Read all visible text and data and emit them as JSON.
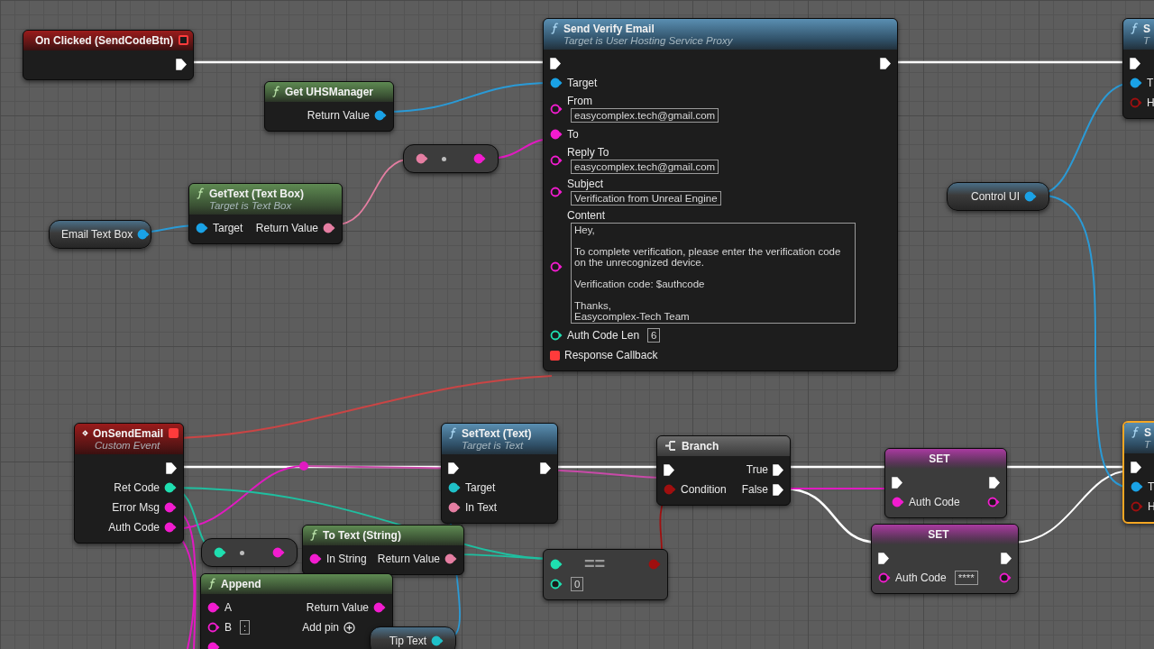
{
  "nodes": [
    {
      "kind": "event",
      "title": "On Clicked (SendCodeBtn)",
      "selected": false,
      "header_pin": {
        "kind": "delegate",
        "color": "#ff3b3b",
        "connected": false
      },
      "rows": [
        {
          "out": {
            "kind": "exec",
            "connected": true
          }
        }
      ]
    },
    {
      "kind": "pure",
      "title": "Get UHSManager",
      "selected": false,
      "rows": [
        {
          "out": {
            "kind": "data",
            "label": "Return Value",
            "color": "#1aa2e6",
            "connected": true
          }
        }
      ]
    },
    {
      "kind": "convert",
      "selected": false,
      "rows": [
        {
          "in": {
            "kind": "data",
            "color": "#e57ea2",
            "connected": true
          },
          "out": {
            "kind": "data",
            "color": "#f21ccf",
            "connected": true
          }
        }
      ]
    },
    {
      "kind": "pure",
      "title": "GetText (Text Box)",
      "subtitle": "Target is Text Box",
      "selected": false,
      "rows": [
        {
          "in": {
            "kind": "data",
            "label": "Target",
            "color": "#1aa2e6",
            "connected": true
          },
          "out": {
            "kind": "data",
            "label": "Return Value",
            "color": "#e57ea2",
            "connected": true
          }
        }
      ]
    },
    {
      "kind": "variable",
      "selected": false,
      "rows": [
        {
          "out": {
            "kind": "data",
            "label": "Email Text Box",
            "color": "#1aa2e6",
            "connected": true
          }
        }
      ]
    },
    {
      "kind": "call",
      "title": "Send Verify Email",
      "subtitle": "Target is User Hosting Service Proxy",
      "selected": false,
      "rows": [
        {
          "in": {
            "kind": "exec",
            "connected": true
          },
          "out": {
            "kind": "exec",
            "connected": true
          }
        },
        {
          "in": {
            "kind": "data",
            "label": "Target",
            "color": "#1aa2e6",
            "connected": true
          }
        },
        {
          "in": {
            "kind": "field",
            "label": "From",
            "color": "#f21ccf",
            "connected": false,
            "value": "easycomplex.tech@gmail.com"
          }
        },
        {
          "in": {
            "kind": "data",
            "label": "To",
            "color": "#f21ccf",
            "connected": true
          }
        },
        {
          "in": {
            "kind": "field",
            "label": "Reply To",
            "color": "#f21ccf",
            "connected": false,
            "value": "easycomplex.tech@gmail.com"
          }
        },
        {
          "in": {
            "kind": "field",
            "label": "Subject",
            "color": "#f21ccf",
            "connected": false,
            "value": "Verification from Unreal Engine"
          }
        },
        {
          "in": {
            "kind": "multiline",
            "label": "Content",
            "color": "#f21ccf",
            "connected": false,
            "value": "Hey,\n\nTo complete verification, please enter the verification code on the unrecognized device.\n\nVerification code: $authcode\n\nThanks,\nEasycomplex-Tech Team"
          }
        },
        {
          "in": {
            "kind": "data",
            "label": "Auth Code Len",
            "color": "#1fdfb0",
            "connected": false,
            "value": "6"
          }
        },
        {
          "in": {
            "kind": "delegate",
            "label": "Response Callback",
            "color": "#ff3b3b",
            "connected": true
          }
        }
      ]
    },
    {
      "kind": "call",
      "title": "S",
      "subtitle": "T",
      "selected": false,
      "rows": [
        {
          "in": {
            "kind": "exec",
            "connected": true
          }
        },
        {
          "in": {
            "kind": "data",
            "label": "T",
            "color": "#1aa2e6",
            "connected": true
          }
        },
        {
          "in": {
            "kind": "data",
            "label": "H",
            "color": "#a00f0f",
            "connected": false
          }
        }
      ]
    },
    {
      "kind": "variable",
      "selected": false,
      "rows": [
        {
          "out": {
            "kind": "data",
            "label": "Control UI",
            "color": "#1aa2e6",
            "connected": true
          }
        }
      ]
    },
    {
      "kind": "event",
      "title": "OnSendEmail",
      "subtitle": "Custom Event",
      "selected": false,
      "header_pin": {
        "kind": "delegate",
        "color": "#ff3b3b",
        "connected": true
      },
      "rows": [
        {
          "out": {
            "kind": "exec",
            "connected": true
          }
        },
        {
          "out": {
            "kind": "data",
            "label": "Ret Code",
            "color": "#1fdfb0",
            "connected": true
          }
        },
        {
          "out": {
            "kind": "data",
            "label": "Error Msg",
            "color": "#f21ccf",
            "connected": true
          }
        },
        {
          "out": {
            "kind": "data",
            "label": "Auth Code",
            "color": "#f21ccf",
            "connected": true
          }
        }
      ]
    },
    {
      "kind": "call",
      "title": "SetText (Text)",
      "subtitle": "Target is Text",
      "selected": false,
      "rows": [
        {
          "in": {
            "kind": "exec",
            "connected": true
          },
          "out": {
            "kind": "exec",
            "connected": true
          }
        },
        {
          "in": {
            "kind": "data",
            "label": "Target",
            "color": "#1fc0c8",
            "connected": true
          }
        },
        {
          "in": {
            "kind": "data",
            "label": "In Text",
            "color": "#e57ea2",
            "connected": true
          }
        }
      ]
    },
    {
      "kind": "branch",
      "title": "Branch",
      "selected": false,
      "rows": [
        {
          "in": {
            "kind": "exec",
            "connected": true
          },
          "out": {
            "kind": "exec",
            "label": "True",
            "connected": true
          }
        },
        {
          "in": {
            "kind": "data",
            "label": "Condition",
            "color": "#a00f0f",
            "connected": true
          },
          "out": {
            "kind": "exec",
            "label": "False",
            "connected": true
          }
        }
      ]
    },
    {
      "kind": "set",
      "title": "SET",
      "selected": false,
      "rows": [
        {
          "in": {
            "kind": "exec",
            "connected": true
          },
          "out": {
            "kind": "exec",
            "connected": true
          }
        },
        {
          "in": {
            "kind": "data",
            "label": "Auth Code",
            "color": "#f21ccf",
            "connected": true
          },
          "out": {
            "kind": "data",
            "color": "#f21ccf",
            "connected": false
          }
        }
      ]
    },
    {
      "kind": "set",
      "title": "SET",
      "selected": false,
      "rows": [
        {
          "in": {
            "kind": "exec",
            "connected": true
          },
          "out": {
            "kind": "exec",
            "connected": true
          }
        },
        {
          "in": {
            "kind": "data",
            "label": "Auth Code",
            "color": "#f21ccf",
            "connected": false,
            "value": "****"
          },
          "out": {
            "kind": "data",
            "color": "#f21ccf",
            "connected": false
          }
        }
      ]
    },
    {
      "kind": "call",
      "title": "S",
      "subtitle": "T",
      "selected": true,
      "rows": [
        {
          "in": {
            "kind": "exec",
            "connected": true
          }
        },
        {
          "in": {
            "kind": "data",
            "label": "T",
            "color": "#1aa2e6",
            "connected": true
          }
        },
        {
          "in": {
            "kind": "data",
            "label": "H",
            "color": "#a00f0f",
            "connected": false
          }
        }
      ]
    },
    {
      "kind": "convert",
      "selected": false,
      "rows": [
        {
          "in": {
            "kind": "data",
            "color": "#1fdfb0",
            "connected": true
          },
          "out": {
            "kind": "data",
            "color": "#f21ccf",
            "connected": true
          }
        }
      ]
    },
    {
      "kind": "pure",
      "title": "To Text (String)",
      "selected": false,
      "rows": [
        {
          "in": {
            "kind": "data",
            "label": "In String",
            "color": "#f21ccf",
            "connected": true
          },
          "out": {
            "kind": "data",
            "label": "Return Value",
            "color": "#e57ea2",
            "connected": true
          }
        }
      ]
    },
    {
      "kind": "compare",
      "title": "==",
      "selected": false,
      "rows": [
        {
          "in": {
            "kind": "data",
            "color": "#1fdfb0",
            "connected": true
          },
          "out": {
            "kind": "data",
            "color": "#a00f0f",
            "connected": true
          }
        },
        {
          "in": {
            "kind": "data",
            "color": "#1fdfb0",
            "connected": false,
            "value": "0"
          }
        }
      ]
    },
    {
      "kind": "pure",
      "title": "Append",
      "selected": false,
      "rows": [
        {
          "in": {
            "kind": "data",
            "label": "A",
            "color": "#f21ccf",
            "connected": true
          },
          "out": {
            "kind": "data",
            "label": "Return Value",
            "color": "#f21ccf",
            "connected": true
          }
        },
        {
          "in": {
            "kind": "data",
            "label": "B",
            "color": "#f21ccf",
            "connected": false,
            "value": ":"
          },
          "out": {
            "kind": "add",
            "label": "Add pin"
          }
        },
        {
          "in": {
            "kind": "data",
            "color": "#f21ccf",
            "connected": true
          }
        }
      ]
    },
    {
      "kind": "variable",
      "selected": false,
      "rows": [
        {
          "out": {
            "kind": "data",
            "label": "Tip Text",
            "color": "#1fc0c8",
            "connected": true
          }
        }
      ]
    }
  ]
}
